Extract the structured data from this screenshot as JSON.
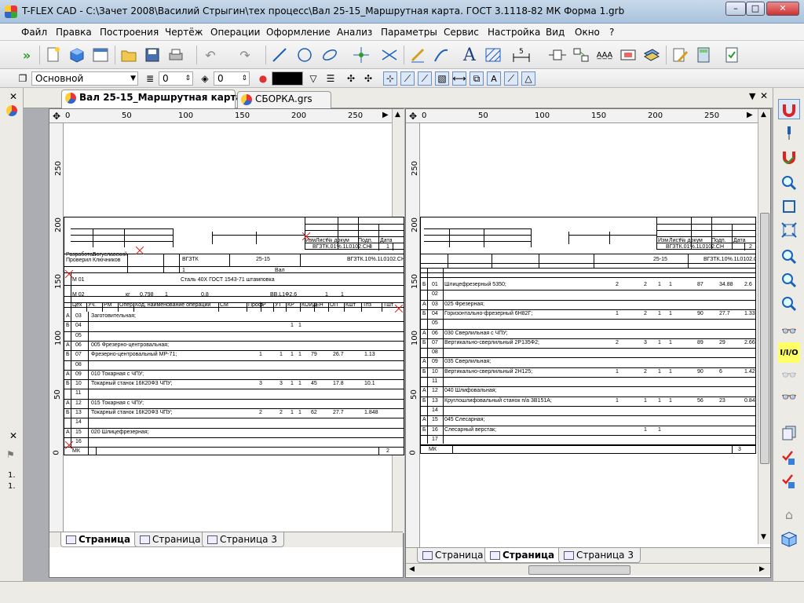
{
  "window": {
    "title": "T-FLEX CAD - C:\\Зачет 2008\\Василий Стрыгин\\тех процесс\\Вал 25-15_Маршрутная карта. ГОСТ 3.1118-82 МК Форма 1.grb",
    "minimize": "–",
    "maximize": "□",
    "close": "✕"
  },
  "menu": [
    "Файл",
    "Правка",
    "Построения",
    "Чертёж",
    "Операции",
    "Оформление",
    "Анализ",
    "Параметры",
    "Сервис",
    "Настройка",
    "Вид",
    "Окно",
    "?"
  ],
  "toolbar2": {
    "layer_value": "Основной",
    "level1_value": "0",
    "level2_value": "0"
  },
  "doc_tabs": [
    "Вал 25-15_Маршрутная карта. Г...",
    "СБОРКА.grs"
  ],
  "left_ruler": {
    "h_ticks": [
      "0",
      "50",
      "100",
      "150",
      "200",
      "250"
    ],
    "v_ticks": [
      "250",
      "200",
      "150",
      "100",
      "50",
      "0"
    ]
  },
  "right_ruler": {
    "h_ticks": [
      "0",
      "50",
      "100",
      "150",
      "200",
      "250"
    ],
    "v_ticks": [
      "250",
      "200",
      "150",
      "100",
      "50",
      "0"
    ]
  },
  "left_page_tabs": [
    "Страница 1",
    "Страница 2",
    "Страница 3"
  ],
  "right_page_tabs": [
    "Страница 1",
    "Страница 2",
    "Страница 3"
  ],
  "left_sheet": {
    "header": {
      "doc_code": "ВГЗТК.01%.1L0102.СН",
      "sheets": "3",
      "sheet": "1",
      "org": "ВГЗТК",
      "part_no": "25-15",
      "part_code": "ВГЗТК.10%.1L0102.СН",
      "part_name": "Вал",
      "developer": "Разработал",
      "developer_name": "Богуславский",
      "checker": "Проверил",
      "checker_name": "Ключников",
      "material": "Сталь 40Х ГОСТ 1543-71  штамповка",
      "m02_vals": [
        "кг",
        "0.798",
        "1",
        "0.8",
        "ВВ.L1Ф2.6",
        "1",
        "1"
      ],
      "col_heads": [
        "Цех",
        "Уч.",
        "РМ",
        "Опер.",
        "Код, наименование операции",
        "СМ",
        "Проф.",
        "Р",
        "УТ",
        "КР",
        "КОИД",
        "ЕН",
        "ОП",
        "Кшт",
        "Тпз",
        "Тшт"
      ],
      "sheet_no": "2",
      "mk": "МК"
    },
    "rows": [
      {
        "k": "А",
        "n": "03",
        "text": "Заготовительная;",
        "vals": [
          "",
          "",
          "",
          "",
          "",
          "",
          ""
        ]
      },
      {
        "k": "Б",
        "n": "04",
        "text": "",
        "vals": [
          "",
          "",
          "1",
          "1",
          "",
          "",
          ""
        ]
      },
      {
        "k": "",
        "n": "05",
        "text": "",
        "vals": []
      },
      {
        "k": "А",
        "n": "06",
        "text": "005   Фрезерно-центровальная;",
        "vals": []
      },
      {
        "k": "Б",
        "n": "07",
        "text": "Фрезерно-центровальный МР-71;",
        "vals": [
          "1",
          "1",
          "1",
          "1",
          "79",
          "26.7",
          "1.13"
        ]
      },
      {
        "k": "",
        "n": "08",
        "text": "",
        "vals": []
      },
      {
        "k": "А",
        "n": "09",
        "text": "010   Токарная с ЧПУ;",
        "vals": []
      },
      {
        "k": "Б",
        "n": "10",
        "text": "Токарный станок 16К20Ф3 ЧПУ;",
        "vals": [
          "3",
          "3",
          "1",
          "1",
          "45",
          "17.8",
          "10.1"
        ]
      },
      {
        "k": "",
        "n": "11",
        "text": "",
        "vals": []
      },
      {
        "k": "А",
        "n": "12",
        "text": "015   Токарная с ЧПУ;",
        "vals": []
      },
      {
        "k": "Б",
        "n": "13",
        "text": "Токарный станок 16К20Ф3 ЧПУ;",
        "vals": [
          "2",
          "2",
          "1",
          "1",
          "62",
          "27.7",
          "1.848"
        ]
      },
      {
        "k": "",
        "n": "14",
        "text": "",
        "vals": []
      },
      {
        "k": "А",
        "n": "15",
        "text": "020   Шлицефрезерная;",
        "vals": []
      },
      {
        "k": "",
        "n": "16",
        "text": "",
        "vals": []
      }
    ]
  },
  "right_sheet": {
    "header": {
      "doc_code": "ВГЗТК.01%.1L0102.СН",
      "sheet": "2",
      "part_no": "25-15",
      "part_code": "ВГЗТК.10%.1L0102.СН",
      "sheet_no": "3",
      "mk": "МК"
    },
    "rows": [
      {
        "k": "Б",
        "n": "01",
        "text": "Шлицефрезерный 5350;",
        "vals": [
          "2",
          "2",
          "1",
          "1",
          "87",
          "34.88",
          "2.6"
        ]
      },
      {
        "k": "",
        "n": "02",
        "text": "",
        "vals": []
      },
      {
        "k": "А",
        "n": "03",
        "text": "025   Фрезерная;",
        "vals": []
      },
      {
        "k": "Б",
        "n": "04",
        "text": "Горизонтально-фрезерный 6Н82Г;",
        "vals": [
          "1",
          "2",
          "1",
          "1",
          "90",
          "27.7",
          "1.33"
        ]
      },
      {
        "k": "",
        "n": "05",
        "text": "",
        "vals": []
      },
      {
        "k": "А",
        "n": "06",
        "text": "030   Сверлильная с ЧПУ;",
        "vals": []
      },
      {
        "k": "Б",
        "n": "07",
        "text": "Вертикально-сверлильный 2Р135Ф2;",
        "vals": [
          "2",
          "3",
          "1",
          "1",
          "89",
          "29",
          "2.66"
        ]
      },
      {
        "k": "",
        "n": "08",
        "text": "",
        "vals": []
      },
      {
        "k": "А",
        "n": "09",
        "text": "035   Сверлильная;",
        "vals": []
      },
      {
        "k": "Б",
        "n": "10",
        "text": "Вертикально-сверлильный 2Н125;",
        "vals": [
          "1",
          "2",
          "1",
          "1",
          "90",
          "6",
          "1.42"
        ]
      },
      {
        "k": "",
        "n": "11",
        "text": "",
        "vals": []
      },
      {
        "k": "А",
        "n": "12",
        "text": "040   Шлифовальная;",
        "vals": []
      },
      {
        "k": "Б",
        "n": "13",
        "text": "Круглошлифовальный станок п/а 3В151А;",
        "vals": [
          "1",
          "1",
          "1",
          "1",
          "56",
          "23",
          "0.843"
        ]
      },
      {
        "k": "",
        "n": "14",
        "text": "",
        "vals": []
      },
      {
        "k": "А",
        "n": "15",
        "text": "045   Слесарная;",
        "vals": []
      },
      {
        "k": "Б",
        "n": "16",
        "text": "Слесарный верстак;",
        "vals": [
          "",
          "1",
          "1",
          "",
          "",
          "",
          ""
        ]
      },
      {
        "k": "",
        "n": "17",
        "text": "",
        "vals": []
      }
    ]
  },
  "colors": {
    "accent": "#1c5fb8",
    "marker": "#e02020"
  }
}
